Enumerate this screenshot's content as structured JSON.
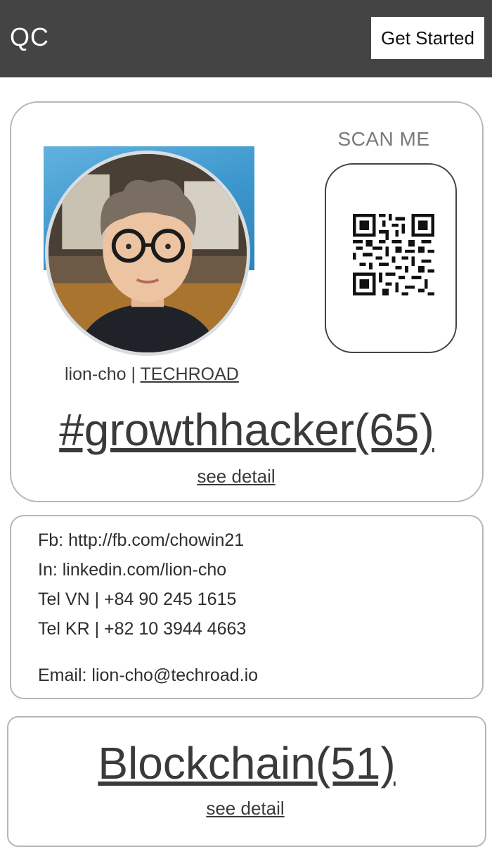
{
  "header": {
    "brand": "QC",
    "cta_label": "Get Started",
    "background_color": "#444444"
  },
  "profile": {
    "photo_icon": "profile-photo-avatar",
    "handle": "lion-cho",
    "separator": "|",
    "company": "TECHROAD",
    "scan_label": "SCAN ME",
    "qr_icon": "qr-code-icon",
    "hashtag": "#growthhacker(65)",
    "detail_link": "see detail"
  },
  "contact": {
    "facebook": "Fb: http://fb.com/chowin21",
    "linkedin": "In: linkedin.com/lion-cho",
    "tel_vn": "Tel VN | +84 90 245 1615",
    "tel_kr": "Tel KR | +82 10 3944 4663",
    "email": "Email: lion-cho@techroad.io"
  },
  "topic": {
    "title": "Blockchain(51)",
    "detail_link": "see detail"
  }
}
